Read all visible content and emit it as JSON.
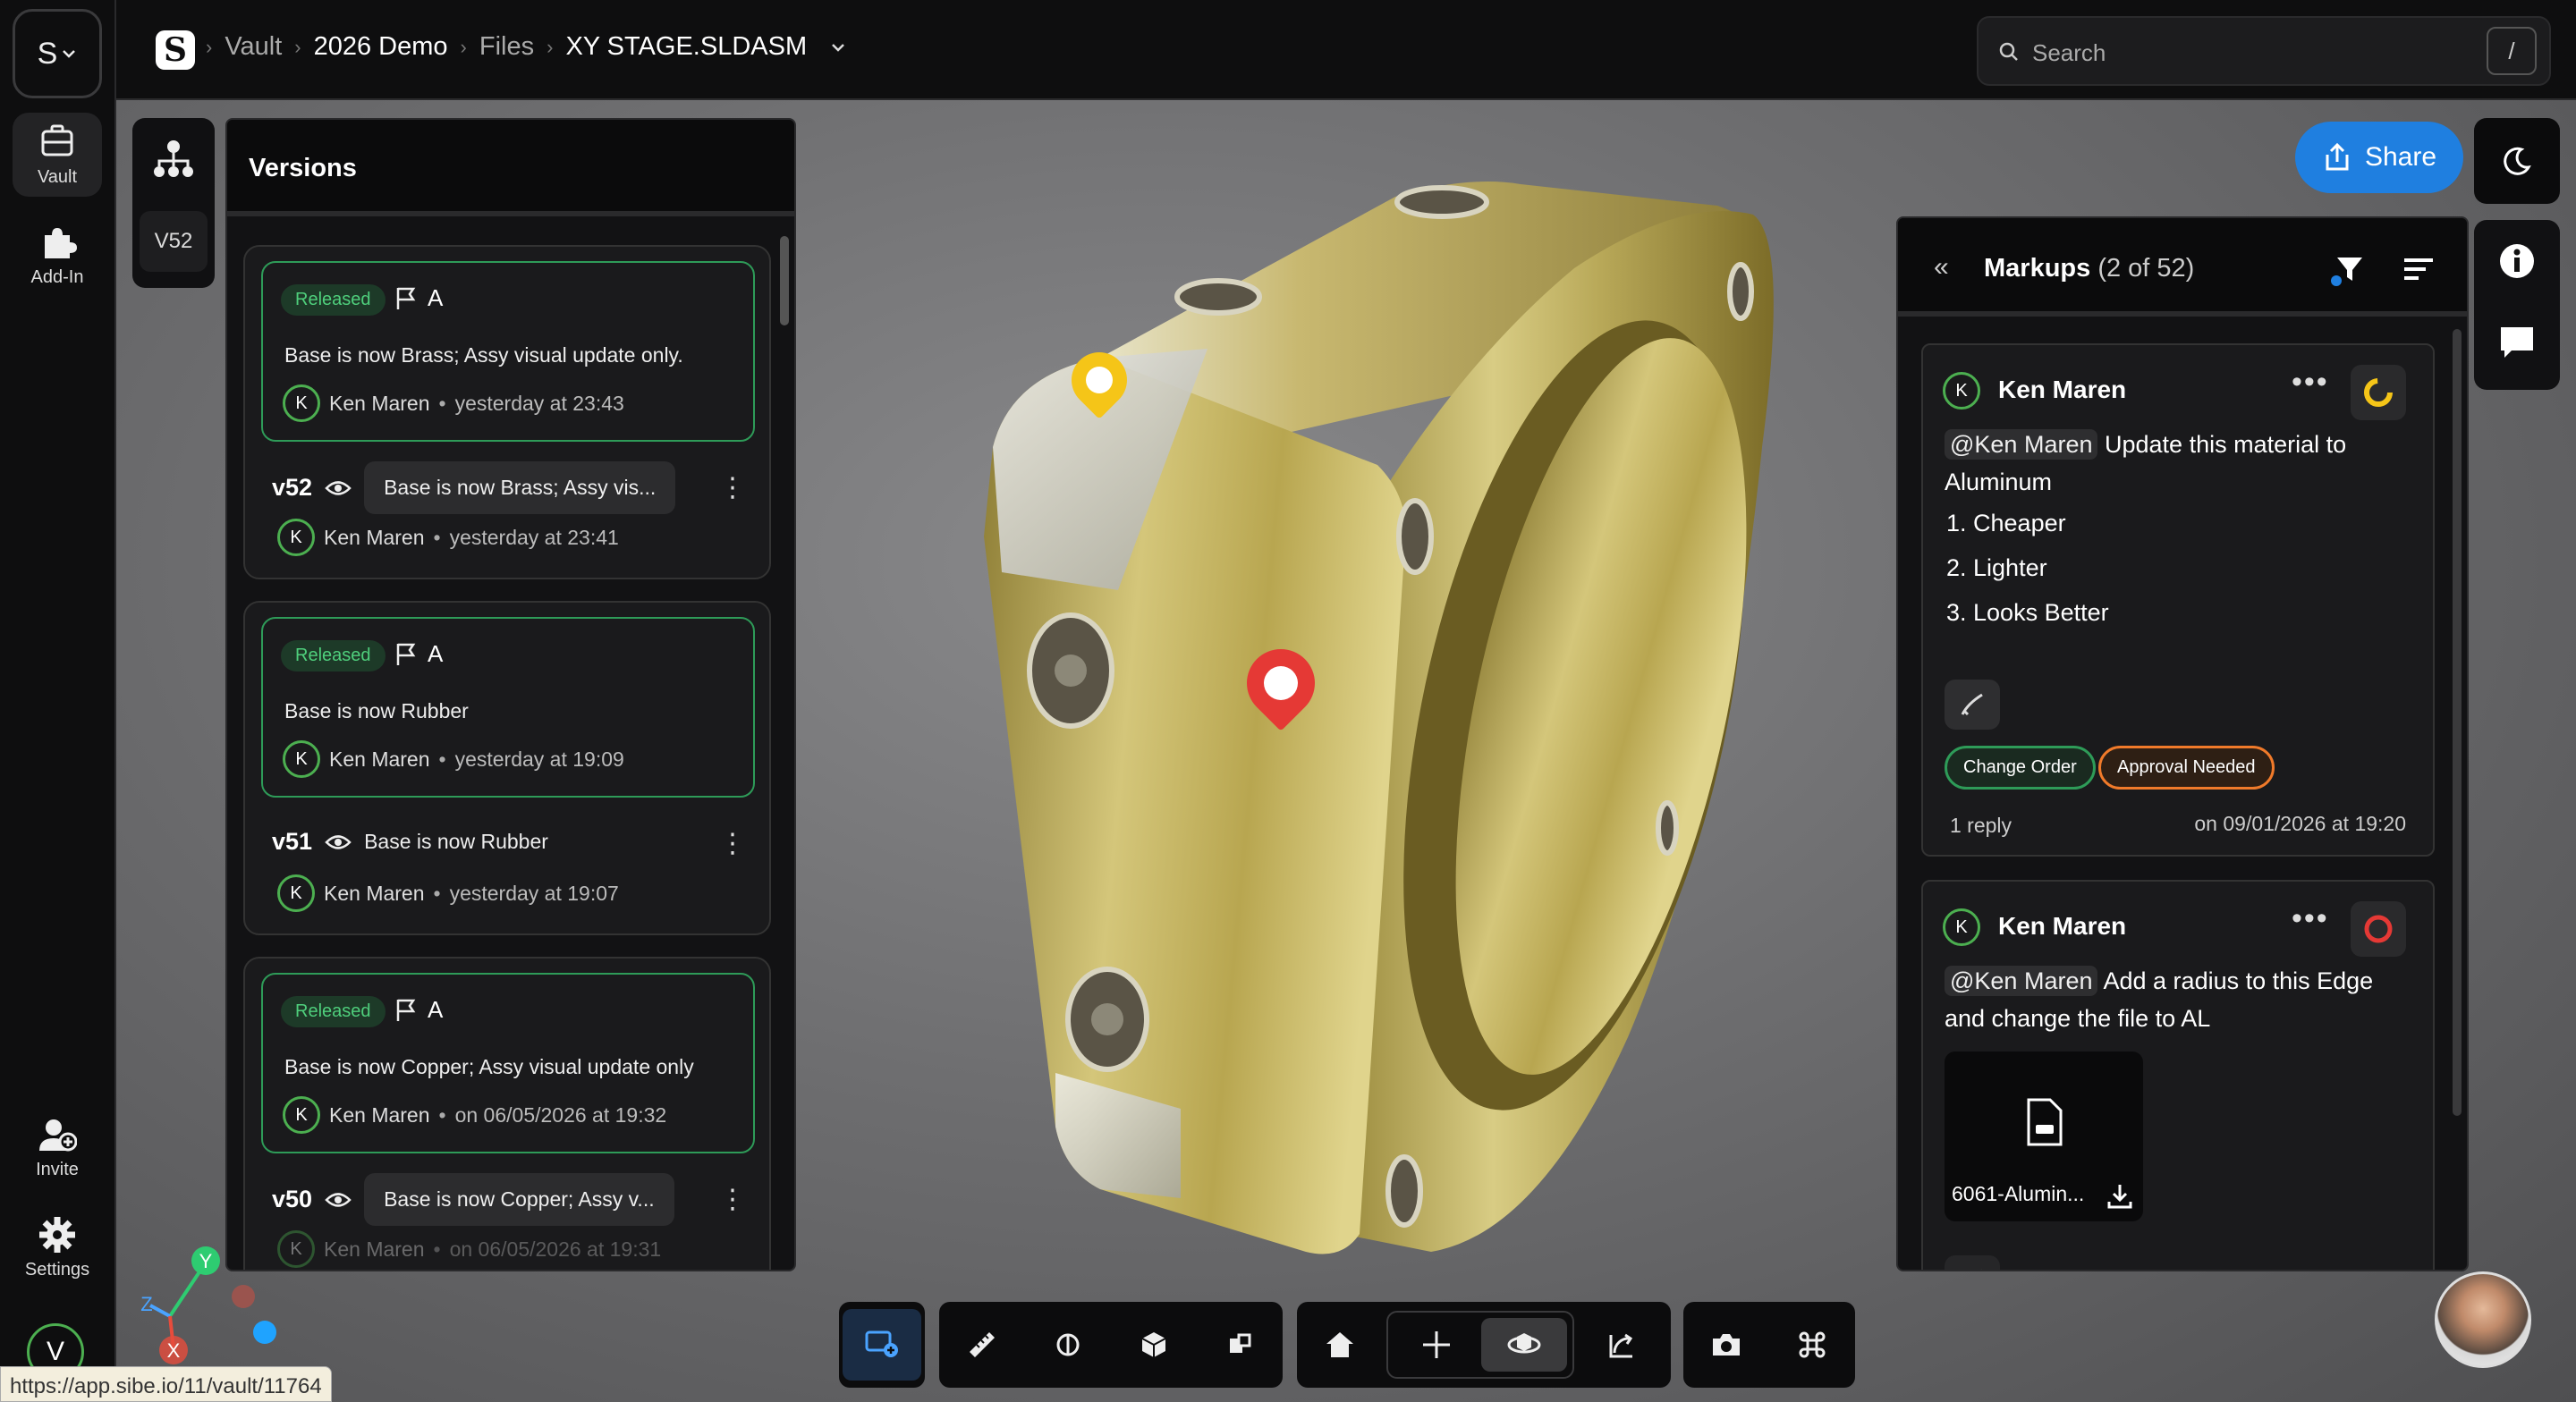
{
  "rail": {
    "workspace_label": "S",
    "vault_label": "Vault",
    "addin_label": "Add-In",
    "invite_label": "Invite",
    "settings_label": "Settings",
    "user_initial": "V"
  },
  "topbar": {
    "crumbs": [
      "Vault",
      "2026 Demo",
      "Files",
      "XY STAGE.SLDASM"
    ],
    "search_placeholder": "Search",
    "search_shortcut": "/"
  },
  "versions": {
    "strip_tag": "V52",
    "title": "Versions",
    "cards": [
      {
        "status": "Released",
        "rev": "A",
        "release_note": "Base is now Brass; Assy visual update only.",
        "release_author": "Ken Maren",
        "release_when": "yesterday at 23:43",
        "version": "v52",
        "message": "Base is now Brass; Assy vis...",
        "author": "Ken Maren",
        "when": "yesterday at 23:41"
      },
      {
        "status": "Released",
        "rev": "A",
        "release_note": "Base is now Rubber",
        "release_author": "Ken Maren",
        "release_when": "yesterday at 19:09",
        "version": "v51",
        "message": "Base is now Rubber",
        "author": "Ken Maren",
        "when": "yesterday at 19:07"
      },
      {
        "status": "Released",
        "rev": "A",
        "release_note": "Base is now Copper; Assy visual update only",
        "release_author": "Ken Maren",
        "release_when": "on 06/05/2026 at 19:32",
        "version": "v50",
        "message": "Base is now Copper; Assy v...",
        "author": "Ken Maren",
        "when": "on 06/05/2026 at 19:31"
      }
    ],
    "initial": "K"
  },
  "share_label": "Share",
  "markups": {
    "title": "Markups",
    "count": "(2 of 52)",
    "items": [
      {
        "author": "Ken Maren",
        "mention": "@Ken Maren",
        "text_a": "Update this material to",
        "text_b": "Aluminum",
        "list": [
          "1. Cheaper",
          "2. Lighter",
          "3. Looks Better"
        ],
        "tags": [
          "Change Order",
          "Approval Needed"
        ],
        "replies": "1 reply",
        "date": "on 09/01/2026 at 19:20",
        "status_color": "#f5c518"
      },
      {
        "author": "Ken Maren",
        "mention": "@Ken Maren",
        "text_a": "Add a radius to this Edge",
        "text_b": "and change the file to AL",
        "attachment": "6061-Alumin...",
        "status_color": "#e53935"
      }
    ]
  },
  "status_url": "https://app.sibe.io/11/vault/11764",
  "axes": {
    "y": "Y",
    "z": "Z",
    "x": "X"
  },
  "colors": {
    "accent": "#1f7fe0",
    "released": "#2e9b58",
    "approval": "#f07a2a",
    "marker_yellow": "#f5c518",
    "marker_red": "#e53935"
  }
}
